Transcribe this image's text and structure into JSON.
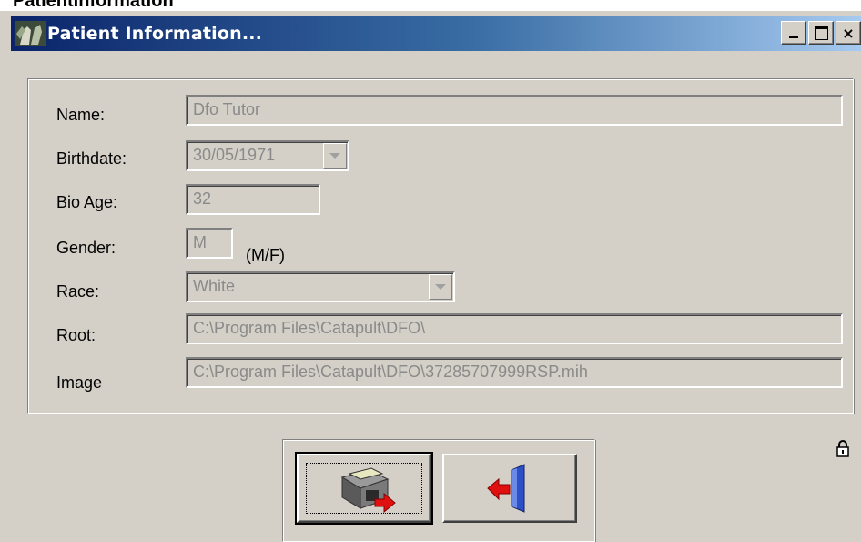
{
  "page_header": "PatientInformation",
  "window": {
    "title": "Patient Information...",
    "controls": {
      "minimize": "minimize-icon",
      "maximize": "maximize-icon",
      "close": "×"
    }
  },
  "form": {
    "name": {
      "label": "Name:",
      "value": "Dfo Tutor"
    },
    "birthdate": {
      "label": "Birthdate:",
      "value": "30/05/1971"
    },
    "bio_age": {
      "label": "Bio Age:",
      "value": "32"
    },
    "gender": {
      "label": "Gender:",
      "value": "M",
      "hint": "(M/F)"
    },
    "race": {
      "label": "Race:",
      "value": "White"
    },
    "root": {
      "label": "Root:",
      "value": "C:\\Program Files\\Catapult\\DFO\\"
    },
    "image": {
      "label": "Image",
      "value": "C:\\Program Files\\Catapult\\DFO\\37285707999RSP.mih"
    }
  },
  "buttons": {
    "save": "save-icon",
    "exit": "exit-door-icon"
  },
  "icons": {
    "app": "app-icon",
    "lock": "lock-icon"
  }
}
